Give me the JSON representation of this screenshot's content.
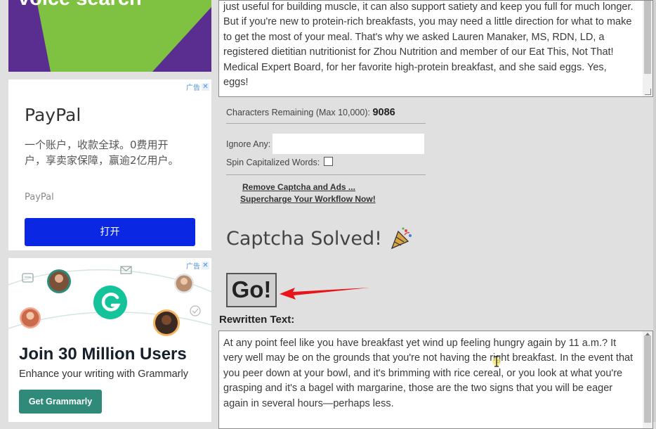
{
  "ads": {
    "top_banner": {
      "headline": "voice search"
    },
    "ad_tag_label": "广告",
    "paypal": {
      "title": "PayPal",
      "description": "一个账户，收款全球。0费用开户，享卖家保障，赢逾2亿用户。",
      "brand": "PayPal",
      "button": "打开"
    },
    "grammarly": {
      "title": "Join 30 Million Users",
      "subtitle": "Enhance your writing with Grammarly",
      "button": "Get Grammarly"
    }
  },
  "original_text": {
    "value": "just useful for building muscle, it can also support satiety and keep you full for much longer. But if you're new to protein-rich breakfasts, you may need a little direction for what to make to get the most of your meal. That's why we asked Lauren Manaker, MS, RDN, LD, a registered dietitian nutritionist for Zhou Nutrition and member of our Eat This, Not That! Medical Expert Board, for her favorite high-protein breakfast, and she said eggs. Yes, eggs!"
  },
  "chars_remaining": {
    "label": "Characters Remaining (Max 10,000):",
    "value": "9086"
  },
  "ignore_any": {
    "label": "Ignore Any:",
    "value": ""
  },
  "spin_capitalized": {
    "label": "Spin Capitalized Words:",
    "checked": false
  },
  "upsell": {
    "remove_captcha": "Remove Captcha and Ads ...",
    "supercharge": "Supercharge Your Workflow Now!"
  },
  "captcha_status": "Captcha Solved!",
  "go_button": "Go!",
  "rewritten": {
    "label": "Rewritten Text:",
    "value": "At any point feel like you have breakfast yet wind up feeling hungry again by 11 a.m.? It very well may be on the grounds that you're not having the right breakfast. In the event that you peer down at your bowl, and it's brimming with rice cereal, or you look at what you're grasping and it's a bagel with margarine, those are the two signs that you will be eager again in several hours—perhaps less."
  },
  "colors": {
    "page_bg": "#e0e0e0",
    "paypal_button": "#0a27e4",
    "grammarly_button": "#2f8a79",
    "annotation_arrow": "#e8141a",
    "top_ad_bg": "#5a2d91",
    "top_ad_wedge": "#7fc242"
  }
}
